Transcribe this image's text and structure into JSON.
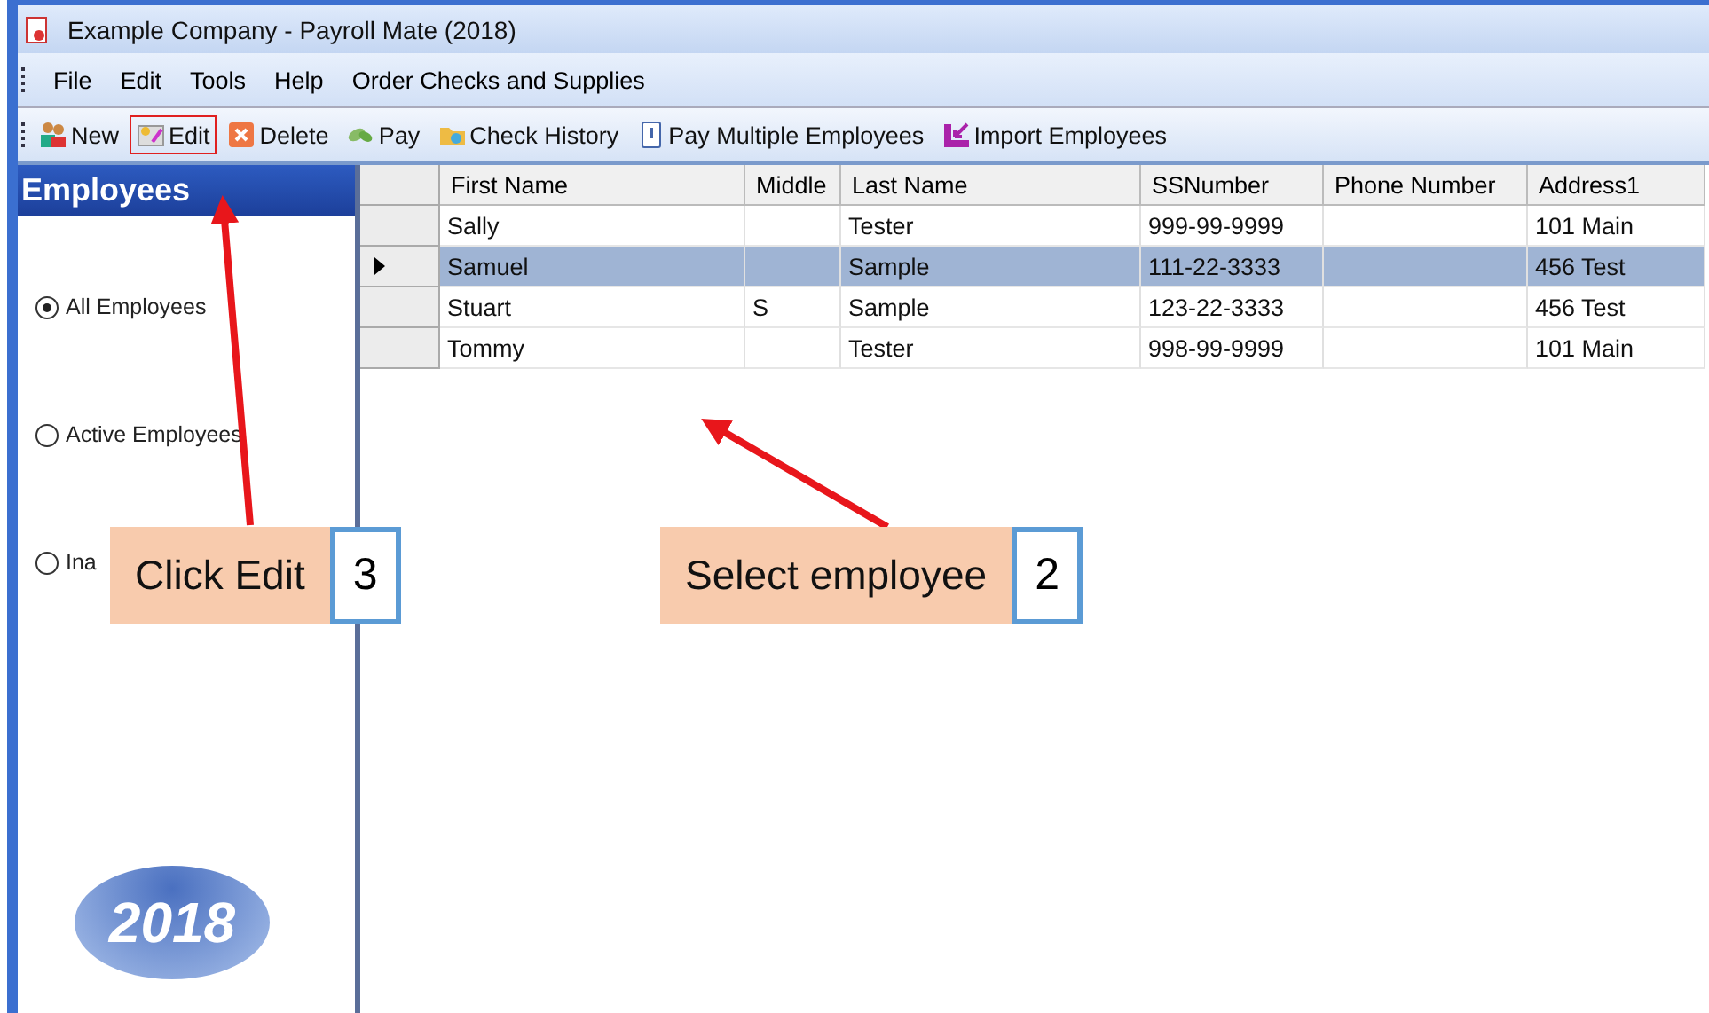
{
  "window": {
    "title": "Example Company - Payroll Mate (2018)"
  },
  "menu": [
    "File",
    "Edit",
    "Tools",
    "Help",
    "Order Checks and Supplies"
  ],
  "toolbar": [
    {
      "label": "New",
      "highlighted": false
    },
    {
      "label": "Edit",
      "highlighted": true
    },
    {
      "label": "Delete",
      "highlighted": false
    },
    {
      "label": "Pay",
      "highlighted": false
    },
    {
      "label": "Check History",
      "highlighted": false
    },
    {
      "label": "Pay Multiple Employees",
      "highlighted": false
    },
    {
      "label": "Import Employees",
      "highlighted": false
    }
  ],
  "sidebar": {
    "title": "Employees",
    "options": [
      {
        "label": "All Employees",
        "selected": true
      },
      {
        "label": "Active Employees",
        "selected": false
      },
      {
        "label": "Ina",
        "selected": false
      }
    ],
    "logo": "2018"
  },
  "table": {
    "columns": [
      "First Name",
      "Middle",
      "Last Name",
      "SSNumber",
      "Phone Number",
      "Address1"
    ],
    "rows": [
      {
        "cells": [
          "Sally",
          "",
          "Tester",
          "999-99-9999",
          "",
          "101 Main"
        ],
        "selected": false
      },
      {
        "cells": [
          "Samuel",
          "",
          "Sample",
          "111-22-3333",
          "",
          "456 Test"
        ],
        "selected": true
      },
      {
        "cells": [
          "Stuart",
          "S",
          "Sample",
          "123-22-3333",
          "",
          "456 Test"
        ],
        "selected": false
      },
      {
        "cells": [
          "Tommy",
          "",
          "Tester",
          "998-99-9999",
          "",
          "101 Main"
        ],
        "selected": false
      }
    ]
  },
  "callouts": [
    {
      "text": "Click Edit",
      "number": "3"
    },
    {
      "text": "Select employee",
      "number": "2"
    }
  ]
}
